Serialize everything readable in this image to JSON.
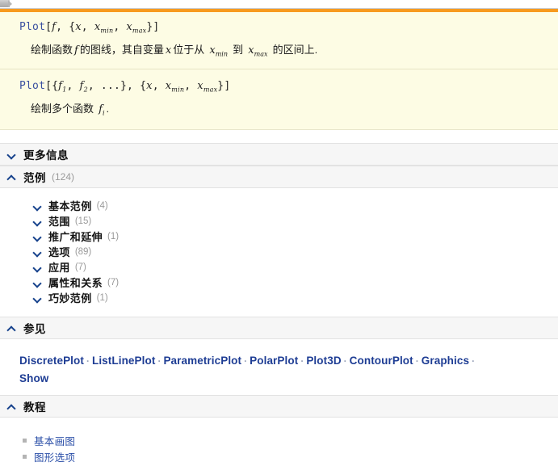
{
  "window": {
    "accent_orange": "#f79a1e",
    "usage_bg": "#fdfce4",
    "section_bg": "#f6f6f6",
    "link_color": "#1e3d94"
  },
  "usage": [
    {
      "code_prefix": "Plot",
      "code_body": "[f, {x, xmin, xmax}]",
      "code_tokens": {
        "open": "[",
        "f": "f",
        "comma1": ", ",
        "brace_open": "{",
        "x": "x",
        "comma2": ", ",
        "xmin_base": "x",
        "xmin_sub": "min",
        "comma3": ", ",
        "xmax_base": "x",
        "xmax_sub": "max",
        "brace_close": "}",
        "close": "]"
      },
      "desc_parts": {
        "p1": "绘制函数",
        "v1": "f",
        "p2": "的图线，其自变量",
        "v2": "x",
        "p3": "位于从",
        "v3_base": "x",
        "v3_sub": "min",
        "p4": "到",
        "v4_base": "x",
        "v4_sub": "max",
        "p5": "的区间上."
      }
    },
    {
      "code_tokens": {
        "prefix": "Plot",
        "open": "[{",
        "f1_base": "f",
        "f1_sub": "1",
        "comma1": ", ",
        "f2_base": "f",
        "f2_sub": "2",
        "comma2": ", ",
        "ellipsis": "...",
        "brace_close": "}",
        "comma3": ", ",
        "brace_open2": "{",
        "x": "x",
        "comma4": ", ",
        "xmin_base": "x",
        "xmin_sub": "min",
        "comma5": ", ",
        "xmax_base": "x",
        "xmax_sub": "max",
        "brace_close2": "}",
        "close": "]"
      },
      "desc_parts": {
        "p1": "绘制多个函数",
        "v1_base": "f",
        "v1_sub": "i",
        "p2": "."
      }
    }
  ],
  "sections": [
    {
      "id": "more-info",
      "title": "更多信息",
      "count": "",
      "expanded": false,
      "chevron": "chevron-down-icon"
    },
    {
      "id": "examples",
      "title": "范例",
      "count": "(124)",
      "expanded": true,
      "chevron": "chevron-up-icon"
    }
  ],
  "example_subsections": [
    {
      "label": "基本范例",
      "count": "(4)",
      "chevron": "chevron-down-icon"
    },
    {
      "label": "范围",
      "count": "(15)",
      "chevron": "chevron-down-icon"
    },
    {
      "label": "推广和延伸",
      "count": "(1)",
      "chevron": "chevron-down-icon"
    },
    {
      "label": "选项",
      "count": "(89)",
      "chevron": "chevron-down-icon"
    },
    {
      "label": "应用",
      "count": "(7)",
      "chevron": "chevron-down-icon"
    },
    {
      "label": "属性和关系",
      "count": "(7)",
      "chevron": "chevron-down-icon"
    },
    {
      "label": "巧妙范例",
      "count": "(1)",
      "chevron": "chevron-down-icon"
    }
  ],
  "see_also": {
    "title": "参见",
    "count": "",
    "chevron": "chevron-up-icon",
    "separator": "·",
    "links": [
      "DiscretePlot",
      "ListLinePlot",
      "ParametricPlot",
      "PolarPlot",
      "Plot3D",
      "ContourPlot",
      "Graphics",
      "Show"
    ]
  },
  "tutorials": {
    "title": "教程",
    "count": "",
    "chevron": "chevron-up-icon",
    "links": [
      "基本画图",
      "图形选项"
    ]
  }
}
